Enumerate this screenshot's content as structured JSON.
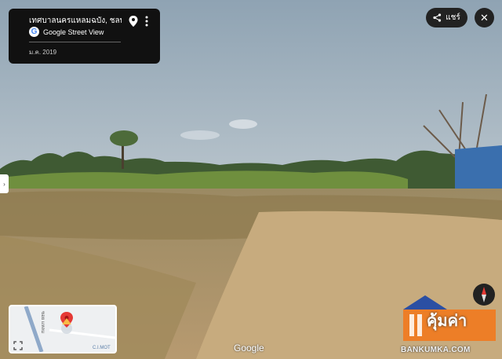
{
  "info_card": {
    "location": "เทศบาลนครแหลมฉบัง, ชลบุรี",
    "service_name": "Google Street View",
    "capture_date": "ม.ค. 2019",
    "pin_icon": "location-pin-icon",
    "more_icon": "more-vert-icon"
  },
  "toolbar": {
    "share_label": "แชร์",
    "share_icon": "share-icon",
    "close_icon": "close-icon"
  },
  "minimap": {
    "road_label": "ซอย แหลม",
    "place_label": "C.I.MOT",
    "expand_icon": "expand-icon"
  },
  "watermark": {
    "google": "Google"
  },
  "logo": {
    "name": "คุ้มค่า",
    "url": "BANKUMKA.COM",
    "brand_color": "#f07a1f",
    "accent_color": "#2b4fa3"
  }
}
